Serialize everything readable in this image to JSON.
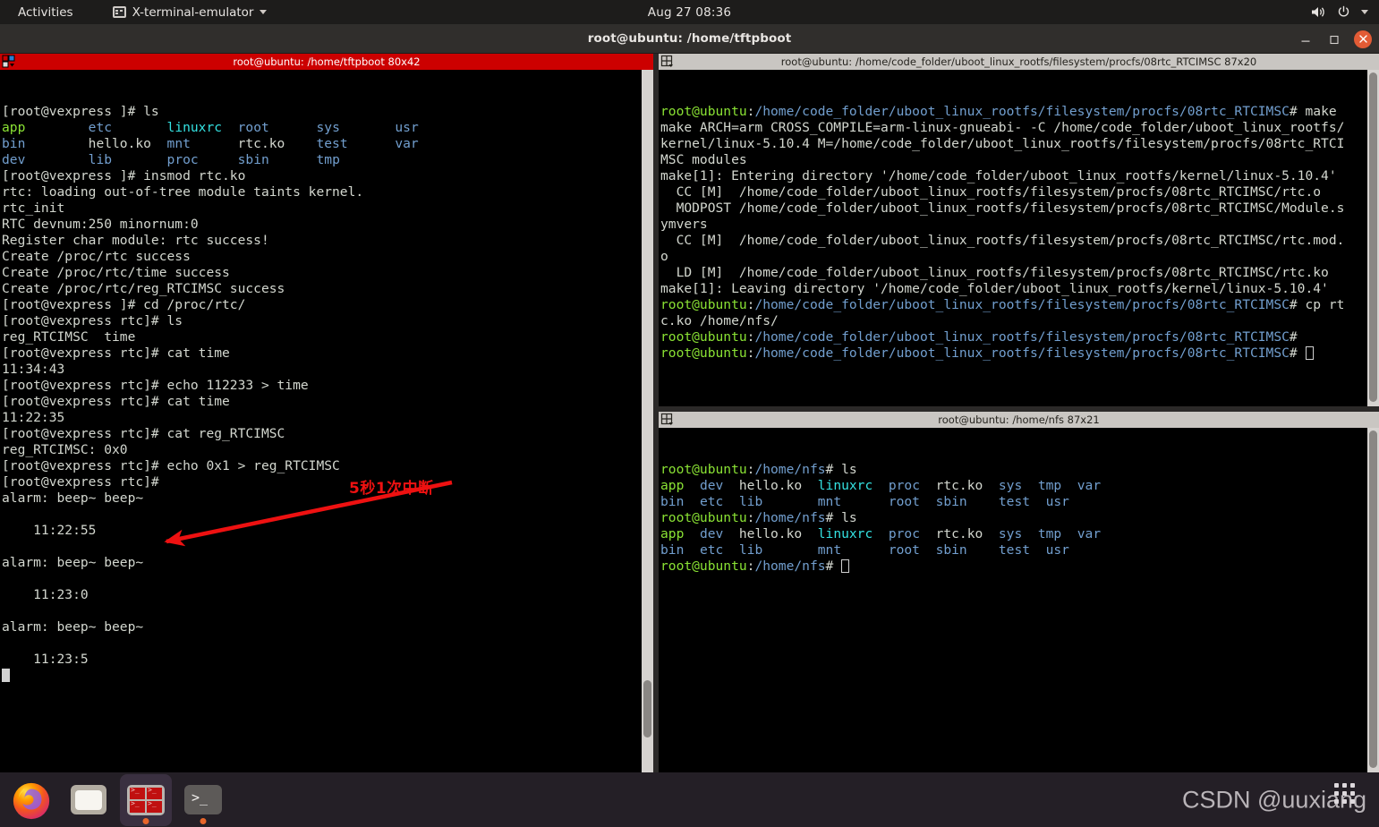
{
  "topbar": {
    "activities": "Activities",
    "app_name": "X-terminal-emulator",
    "app_icon": "terminal-icon",
    "clock": "Aug 27  08:36",
    "volume_icon": "volume-icon",
    "power_icon": "power-icon",
    "menu_caret_icon": "chevron-down-icon"
  },
  "window": {
    "title": "root@ubuntu: /home/tftpboot",
    "minimize_label": "–",
    "maximize_label": "❐",
    "close_label": "✕"
  },
  "panes": {
    "left": {
      "title": "root@ubuntu: /home/tftpboot 80x42",
      "active": true,
      "lines": [
        [
          {
            "t": "[root@vexpress ]# ls",
            "c": "c-white"
          }
        ],
        [
          {
            "t": "app",
            "c": "c-bgreen"
          },
          {
            "t": "        ",
            "c": "c-white"
          },
          {
            "t": "etc",
            "c": "c-bblue"
          },
          {
            "t": "       ",
            "c": "c-white"
          },
          {
            "t": "linuxrc",
            "c": "c-bcyan"
          },
          {
            "t": "  ",
            "c": "c-white"
          },
          {
            "t": "root",
            "c": "c-bblue"
          },
          {
            "t": "      ",
            "c": "c-white"
          },
          {
            "t": "sys",
            "c": "c-bblue"
          },
          {
            "t": "       ",
            "c": "c-white"
          },
          {
            "t": "usr",
            "c": "c-bblue"
          }
        ],
        [
          {
            "t": "bin",
            "c": "c-bblue"
          },
          {
            "t": "        ",
            "c": "c-white"
          },
          {
            "t": "hello.ko",
            "c": "c-white"
          },
          {
            "t": "  ",
            "c": "c-white"
          },
          {
            "t": "mnt",
            "c": "c-bblue"
          },
          {
            "t": "      ",
            "c": "c-white"
          },
          {
            "t": "rtc.ko",
            "c": "c-white"
          },
          {
            "t": "    ",
            "c": "c-white"
          },
          {
            "t": "test",
            "c": "c-bblue"
          },
          {
            "t": "      ",
            "c": "c-white"
          },
          {
            "t": "var",
            "c": "c-bblue"
          }
        ],
        [
          {
            "t": "dev",
            "c": "c-bblue"
          },
          {
            "t": "        ",
            "c": "c-white"
          },
          {
            "t": "lib",
            "c": "c-bblue"
          },
          {
            "t": "       ",
            "c": "c-white"
          },
          {
            "t": "proc",
            "c": "c-bblue"
          },
          {
            "t": "     ",
            "c": "c-white"
          },
          {
            "t": "sbin",
            "c": "c-bblue"
          },
          {
            "t": "      ",
            "c": "c-white"
          },
          {
            "t": "tmp",
            "c": "c-bblue"
          }
        ],
        [
          {
            "t": "[root@vexpress ]# insmod rtc.ko",
            "c": "c-white"
          }
        ],
        [
          {
            "t": "rtc: loading out-of-tree module taints kernel.",
            "c": "c-white"
          }
        ],
        [
          {
            "t": "rtc_init",
            "c": "c-white"
          }
        ],
        [
          {
            "t": "RTC devnum:250 minornum:0",
            "c": "c-white"
          }
        ],
        [
          {
            "t": "Register char module: rtc success!",
            "c": "c-white"
          }
        ],
        [
          {
            "t": "Create /proc/rtc success",
            "c": "c-white"
          }
        ],
        [
          {
            "t": "Create /proc/rtc/time success",
            "c": "c-white"
          }
        ],
        [
          {
            "t": "Create /proc/rtc/reg_RTCIMSC success",
            "c": "c-white"
          }
        ],
        [
          {
            "t": "[root@vexpress ]# cd /proc/rtc/",
            "c": "c-white"
          }
        ],
        [
          {
            "t": "[root@vexpress rtc]# ls",
            "c": "c-white"
          }
        ],
        [
          {
            "t": "reg_RTCIMSC  time",
            "c": "c-white"
          }
        ],
        [
          {
            "t": "[root@vexpress rtc]# cat time",
            "c": "c-white"
          }
        ],
        [
          {
            "t": "11:34:43",
            "c": "c-white"
          }
        ],
        [
          {
            "t": "[root@vexpress rtc]# echo 112233 > time",
            "c": "c-white"
          }
        ],
        [
          {
            "t": "[root@vexpress rtc]# cat time",
            "c": "c-white"
          }
        ],
        [
          {
            "t": "11:22:35",
            "c": "c-white"
          }
        ],
        [
          {
            "t": "[root@vexpress rtc]# cat reg_RTCIMSC",
            "c": "c-white"
          }
        ],
        [
          {
            "t": "reg_RTCIMSC: 0x0",
            "c": "c-white"
          }
        ],
        [
          {
            "t": "[root@vexpress rtc]# echo 0x1 > reg_RTCIMSC",
            "c": "c-white"
          }
        ],
        [
          {
            "t": "[root@vexpress rtc]#",
            "c": "c-white"
          }
        ],
        [
          {
            "t": "alarm: beep~ beep~",
            "c": "c-white"
          }
        ],
        [
          {
            "t": "",
            "c": "c-white"
          }
        ],
        [
          {
            "t": "    11:22:55",
            "c": "c-white"
          }
        ],
        [
          {
            "t": "",
            "c": "c-white"
          }
        ],
        [
          {
            "t": "alarm: beep~ beep~",
            "c": "c-white"
          }
        ],
        [
          {
            "t": "",
            "c": "c-white"
          }
        ],
        [
          {
            "t": "    11:23:0",
            "c": "c-white"
          }
        ],
        [
          {
            "t": "",
            "c": "c-white"
          }
        ],
        [
          {
            "t": "alarm: beep~ beep~",
            "c": "c-white"
          }
        ],
        [
          {
            "t": "",
            "c": "c-white"
          }
        ],
        [
          {
            "t": "    11:23:5",
            "c": "c-white"
          }
        ]
      ],
      "cursor": "block"
    },
    "right_top": {
      "title": "root@ubuntu: /home/code_folder/uboot_linux_rootfs/filesystem/procfs/08rtc_RTCIMSC 87x20",
      "active": false,
      "lines": [
        [
          {
            "t": "root@ubuntu",
            "c": "c-bgreen"
          },
          {
            "t": ":",
            "c": "c-white"
          },
          {
            "t": "/home/code_folder/uboot_linux_rootfs/filesystem/procfs/08rtc_RTCIMSC",
            "c": "c-bblue"
          },
          {
            "t": "# make",
            "c": "c-white"
          }
        ],
        [
          {
            "t": "make ARCH=arm CROSS_COMPILE=arm-linux-gnueabi- -C /home/code_folder/uboot_linux_rootfs/",
            "c": "c-white"
          }
        ],
        [
          {
            "t": "kernel/linux-5.10.4 M=/home/code_folder/uboot_linux_rootfs/filesystem/procfs/08rtc_RTCI",
            "c": "c-white"
          }
        ],
        [
          {
            "t": "MSC modules",
            "c": "c-white"
          }
        ],
        [
          {
            "t": "make[1]: Entering directory '/home/code_folder/uboot_linux_rootfs/kernel/linux-5.10.4'",
            "c": "c-white"
          }
        ],
        [
          {
            "t": "  CC [M]  /home/code_folder/uboot_linux_rootfs/filesystem/procfs/08rtc_RTCIMSC/rtc.o",
            "c": "c-white"
          }
        ],
        [
          {
            "t": "  MODPOST /home/code_folder/uboot_linux_rootfs/filesystem/procfs/08rtc_RTCIMSC/Module.s",
            "c": "c-white"
          }
        ],
        [
          {
            "t": "ymvers",
            "c": "c-white"
          }
        ],
        [
          {
            "t": "  CC [M]  /home/code_folder/uboot_linux_rootfs/filesystem/procfs/08rtc_RTCIMSC/rtc.mod.",
            "c": "c-white"
          }
        ],
        [
          {
            "t": "o",
            "c": "c-white"
          }
        ],
        [
          {
            "t": "  LD [M]  /home/code_folder/uboot_linux_rootfs/filesystem/procfs/08rtc_RTCIMSC/rtc.ko",
            "c": "c-white"
          }
        ],
        [
          {
            "t": "make[1]: Leaving directory '/home/code_folder/uboot_linux_rootfs/kernel/linux-5.10.4'",
            "c": "c-white"
          }
        ],
        [
          {
            "t": "root@ubuntu",
            "c": "c-bgreen"
          },
          {
            "t": ":",
            "c": "c-white"
          },
          {
            "t": "/home/code_folder/uboot_linux_rootfs/filesystem/procfs/08rtc_RTCIMSC",
            "c": "c-bblue"
          },
          {
            "t": "# cp rt",
            "c": "c-white"
          }
        ],
        [
          {
            "t": "c.ko /home/nfs/",
            "c": "c-white"
          }
        ],
        [
          {
            "t": "root@ubuntu",
            "c": "c-bgreen"
          },
          {
            "t": ":",
            "c": "c-white"
          },
          {
            "t": "/home/code_folder/uboot_linux_rootfs/filesystem/procfs/08rtc_RTCIMSC",
            "c": "c-bblue"
          },
          {
            "t": "#",
            "c": "c-white"
          }
        ],
        [
          {
            "t": "root@ubuntu",
            "c": "c-bgreen"
          },
          {
            "t": ":",
            "c": "c-white"
          },
          {
            "t": "/home/code_folder/uboot_linux_rootfs/filesystem/procfs/08rtc_RTCIMSC",
            "c": "c-bblue"
          },
          {
            "t": "# ",
            "c": "c-white"
          }
        ]
      ],
      "cursor": "hollow"
    },
    "right_bottom": {
      "title": "root@ubuntu: /home/nfs 87x21",
      "active": false,
      "lines": [
        [
          {
            "t": "root@ubuntu",
            "c": "c-bgreen"
          },
          {
            "t": ":",
            "c": "c-white"
          },
          {
            "t": "/home/nfs",
            "c": "c-bblue"
          },
          {
            "t": "# ls",
            "c": "c-white"
          }
        ],
        [
          {
            "t": "app",
            "c": "c-bgreen"
          },
          {
            "t": "  ",
            "c": "c-white"
          },
          {
            "t": "dev",
            "c": "c-bblue"
          },
          {
            "t": "  ",
            "c": "c-white"
          },
          {
            "t": "hello.ko",
            "c": "c-white"
          },
          {
            "t": "  ",
            "c": "c-white"
          },
          {
            "t": "linuxrc",
            "c": "c-bcyan"
          },
          {
            "t": "  ",
            "c": "c-white"
          },
          {
            "t": "proc",
            "c": "c-bblue"
          },
          {
            "t": "  ",
            "c": "c-white"
          },
          {
            "t": "rtc.ko",
            "c": "c-white"
          },
          {
            "t": "  ",
            "c": "c-white"
          },
          {
            "t": "sys",
            "c": "c-bblue"
          },
          {
            "t": "  ",
            "c": "c-white"
          },
          {
            "t": "tmp",
            "c": "c-bblue"
          },
          {
            "t": "  ",
            "c": "c-white"
          },
          {
            "t": "var",
            "c": "c-bblue"
          }
        ],
        [
          {
            "t": "bin",
            "c": "c-bblue"
          },
          {
            "t": "  ",
            "c": "c-white"
          },
          {
            "t": "etc",
            "c": "c-bblue"
          },
          {
            "t": "  ",
            "c": "c-white"
          },
          {
            "t": "lib",
            "c": "c-bblue"
          },
          {
            "t": "       ",
            "c": "c-white"
          },
          {
            "t": "mnt",
            "c": "c-bblue"
          },
          {
            "t": "      ",
            "c": "c-white"
          },
          {
            "t": "root",
            "c": "c-bblue"
          },
          {
            "t": "  ",
            "c": "c-white"
          },
          {
            "t": "sbin",
            "c": "c-bblue"
          },
          {
            "t": "    ",
            "c": "c-white"
          },
          {
            "t": "test",
            "c": "c-bblue"
          },
          {
            "t": "  ",
            "c": "c-white"
          },
          {
            "t": "usr",
            "c": "c-bblue"
          }
        ],
        [
          {
            "t": "root@ubuntu",
            "c": "c-bgreen"
          },
          {
            "t": ":",
            "c": "c-white"
          },
          {
            "t": "/home/nfs",
            "c": "c-bblue"
          },
          {
            "t": "# ls",
            "c": "c-white"
          }
        ],
        [
          {
            "t": "app",
            "c": "c-bgreen"
          },
          {
            "t": "  ",
            "c": "c-white"
          },
          {
            "t": "dev",
            "c": "c-bblue"
          },
          {
            "t": "  ",
            "c": "c-white"
          },
          {
            "t": "hello.ko",
            "c": "c-white"
          },
          {
            "t": "  ",
            "c": "c-white"
          },
          {
            "t": "linuxrc",
            "c": "c-bcyan"
          },
          {
            "t": "  ",
            "c": "c-white"
          },
          {
            "t": "proc",
            "c": "c-bblue"
          },
          {
            "t": "  ",
            "c": "c-white"
          },
          {
            "t": "rtc.ko",
            "c": "c-white"
          },
          {
            "t": "  ",
            "c": "c-white"
          },
          {
            "t": "sys",
            "c": "c-bblue"
          },
          {
            "t": "  ",
            "c": "c-white"
          },
          {
            "t": "tmp",
            "c": "c-bblue"
          },
          {
            "t": "  ",
            "c": "c-white"
          },
          {
            "t": "var",
            "c": "c-bblue"
          }
        ],
        [
          {
            "t": "bin",
            "c": "c-bblue"
          },
          {
            "t": "  ",
            "c": "c-white"
          },
          {
            "t": "etc",
            "c": "c-bblue"
          },
          {
            "t": "  ",
            "c": "c-white"
          },
          {
            "t": "lib",
            "c": "c-bblue"
          },
          {
            "t": "       ",
            "c": "c-white"
          },
          {
            "t": "mnt",
            "c": "c-bblue"
          },
          {
            "t": "      ",
            "c": "c-white"
          },
          {
            "t": "root",
            "c": "c-bblue"
          },
          {
            "t": "  ",
            "c": "c-white"
          },
          {
            "t": "sbin",
            "c": "c-bblue"
          },
          {
            "t": "    ",
            "c": "c-white"
          },
          {
            "t": "test",
            "c": "c-bblue"
          },
          {
            "t": "  ",
            "c": "c-white"
          },
          {
            "t": "usr",
            "c": "c-bblue"
          }
        ],
        [
          {
            "t": "root@ubuntu",
            "c": "c-bgreen"
          },
          {
            "t": ":",
            "c": "c-white"
          },
          {
            "t": "/home/nfs",
            "c": "c-bblue"
          },
          {
            "t": "# ",
            "c": "c-white"
          }
        ]
      ],
      "cursor": "hollow"
    }
  },
  "annotation": {
    "text": "5秒1次中断",
    "color": "#ee1111"
  },
  "dock": {
    "items": [
      {
        "name": "firefox",
        "icon": "firefox-icon",
        "running": false,
        "active": false
      },
      {
        "name": "files",
        "icon": "folder-icon",
        "running": false,
        "active": false
      },
      {
        "name": "terminator",
        "icon": "terminator-icon",
        "running": true,
        "active": true
      },
      {
        "name": "terminal",
        "icon": "terminal-icon",
        "running": true,
        "active": false
      }
    ],
    "watermark": "CSDN @uuxiang",
    "apps_grid_icon": "apps-grid-icon"
  }
}
